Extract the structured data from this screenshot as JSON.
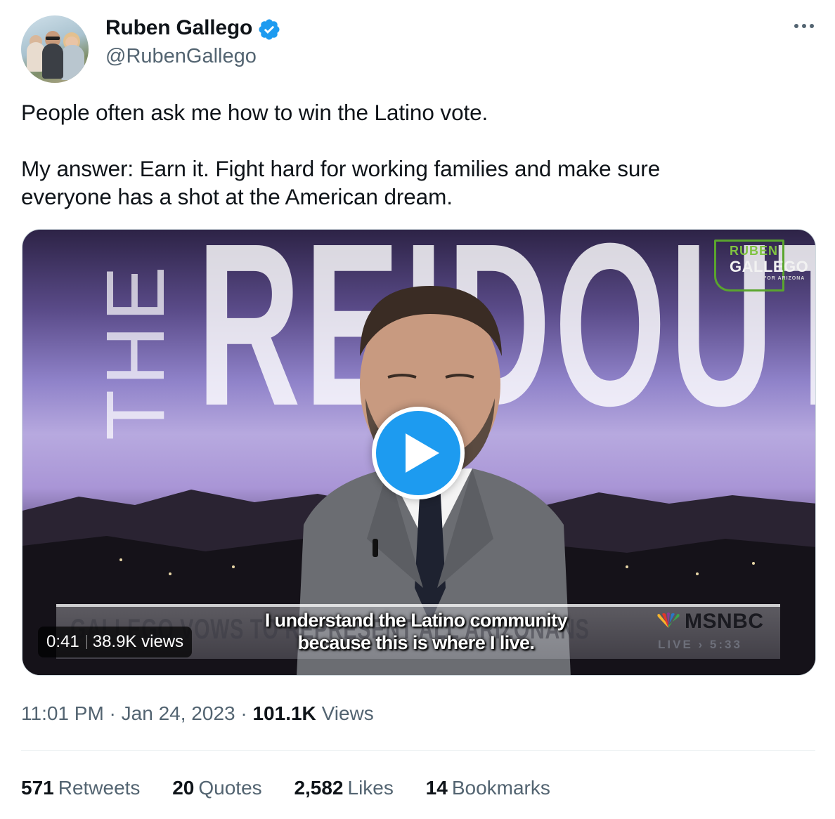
{
  "author": {
    "name": "Ruben Gallego",
    "handle": "@RubenGallego"
  },
  "tweet": {
    "paragraph1": "People often ask me how to win the Latino vote.",
    "paragraph2_line1": "My answer: Earn it. Fight hard for working families and make sure",
    "paragraph2_line2": "everyone has a shot at the American dream."
  },
  "video": {
    "duration": "0:41",
    "views": "38.9K views",
    "background_word": "REIDOUT",
    "background_prefix": "THE",
    "logo": {
      "line1": "RUBEN",
      "line2": "GALLEGO",
      "line3": "FOR ARIZONA"
    },
    "caption_line1": "I understand the Latino community",
    "caption_line2": "because this is where I live.",
    "lower_third_headline": "GALLEGO VOWS TO REPRESENT ALL ARIZONANS",
    "network": "MSNBC",
    "live_label": "LIVE",
    "live_time": "5:33"
  },
  "meta": {
    "time": "11:01 PM",
    "date": "Jan 24, 2023",
    "views_count": "101.1K",
    "views_label": "Views"
  },
  "stats": [
    {
      "count": "571",
      "label": "Retweets"
    },
    {
      "count": "20",
      "label": "Quotes"
    },
    {
      "count": "2,582",
      "label": "Likes"
    },
    {
      "count": "14",
      "label": "Bookmarks"
    }
  ],
  "colors": {
    "accent": "#1d9bf0",
    "text_primary": "#0f1419",
    "text_secondary": "#536471",
    "border": "#cfd9de"
  },
  "icons": {
    "verified": "verified-badge-icon",
    "more": "more-options-icon",
    "play": "play-icon"
  }
}
